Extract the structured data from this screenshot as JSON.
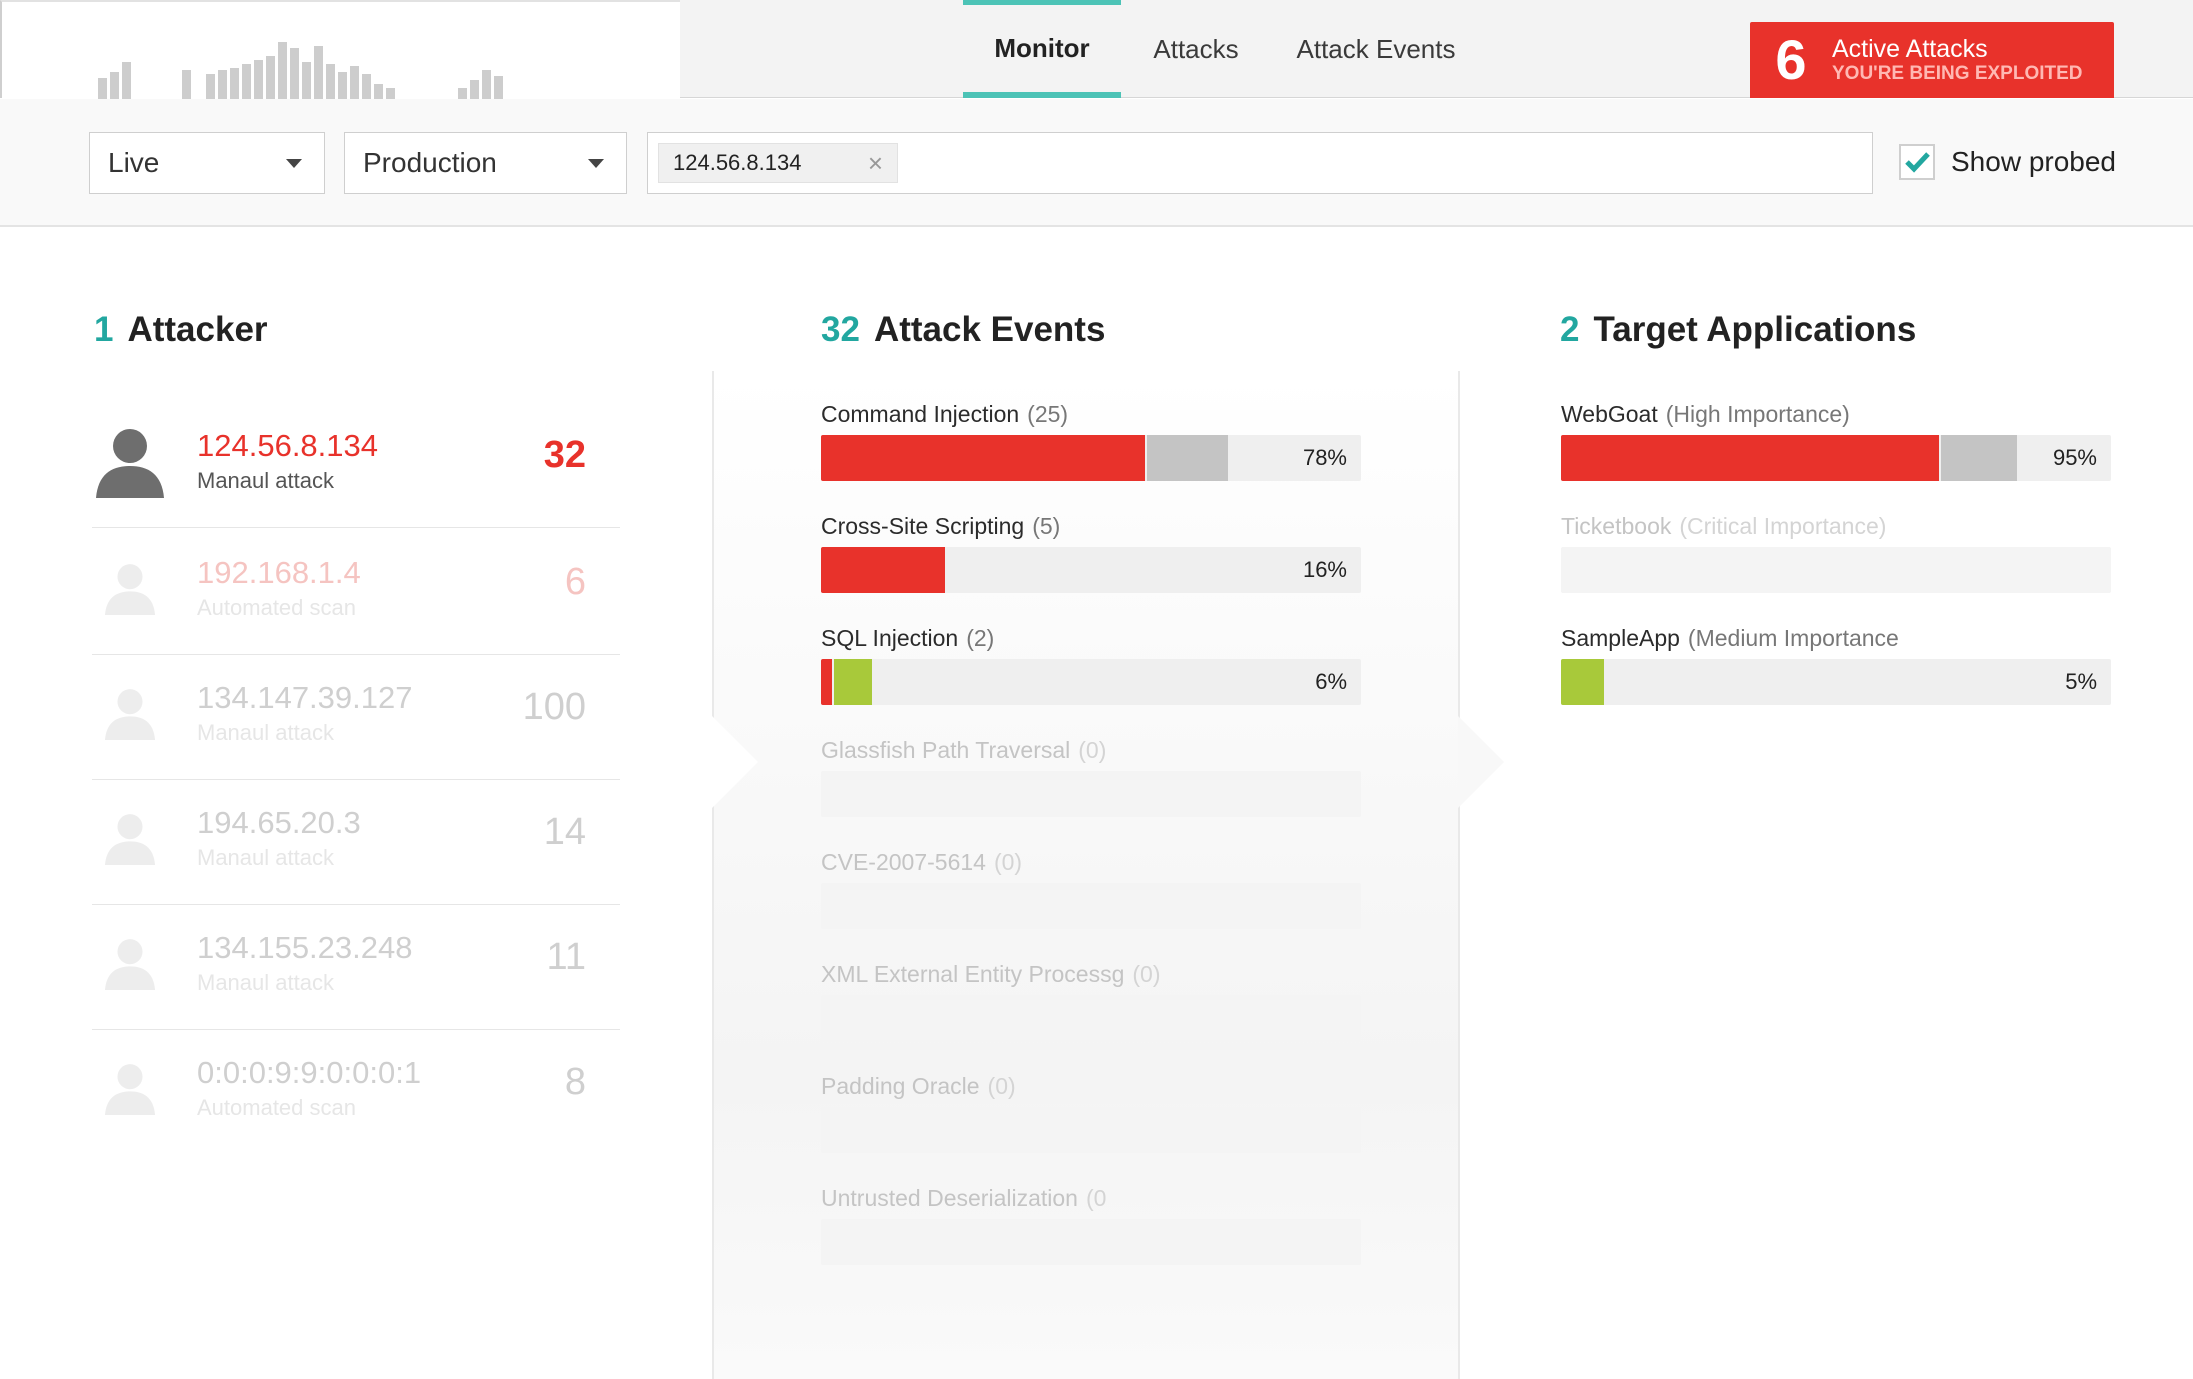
{
  "nav": {
    "tabs": [
      {
        "label": "Monitor",
        "active": true
      },
      {
        "label": "Attacks",
        "active": false
      },
      {
        "label": "Attack Events",
        "active": false
      }
    ]
  },
  "activity_histogram": [
    22,
    28,
    38,
    0,
    0,
    0,
    0,
    30,
    0,
    26,
    30,
    32,
    36,
    40,
    44,
    58,
    52,
    38,
    54,
    36,
    28,
    34,
    26,
    16,
    12,
    0,
    0,
    0,
    0,
    0,
    12,
    20,
    30,
    24
  ],
  "alert": {
    "count": "6",
    "title": "Active Attacks",
    "subtitle": "YOU'RE BEING EXPLOITED"
  },
  "filters": {
    "mode": "Live",
    "environment": "Production",
    "tag": "124.56.8.134",
    "tag_remove": "×",
    "show_probed_label": "Show probed",
    "show_probed_checked": true
  },
  "attackers_section": {
    "count": "1",
    "title": "Attacker"
  },
  "attackers": [
    {
      "ip": "124.56.8.134",
      "kind": "Manaul attack",
      "count": "32",
      "state": "active"
    },
    {
      "ip": "192.168.1.4",
      "kind": "Automated scan",
      "count": "6",
      "state": "faded-red"
    },
    {
      "ip": "134.147.39.127",
      "kind": "Manaul attack",
      "count": "100",
      "state": "faded"
    },
    {
      "ip": "194.65.20.3",
      "kind": "Manaul attack",
      "count": "14",
      "state": "faded"
    },
    {
      "ip": "134.155.23.248",
      "kind": "Manaul attack",
      "count": "11",
      "state": "faded"
    },
    {
      "ip": "0:0:0:9:9:0:0:0:1",
      "kind": "Automated scan",
      "count": "8",
      "state": "faded"
    }
  ],
  "events_section": {
    "count": "32",
    "title": "Attack Events"
  },
  "events": [
    {
      "name": "Command Injection",
      "count": "(25)",
      "percent": "78%",
      "red": 0.6,
      "green": 0,
      "gray": 0.15,
      "dim": false
    },
    {
      "name": "Cross-Site Scripting",
      "count": "(5)",
      "percent": "16%",
      "red": 0.23,
      "green": 0,
      "gray": 0,
      "dim": false
    },
    {
      "name": "SQL Injection",
      "count": "(2)",
      "percent": "6%",
      "red": 0.02,
      "green": 0.07,
      "gray": 0,
      "dim": false
    },
    {
      "name": "Glassfish Path Traversal",
      "count": "(0)",
      "percent": "",
      "red": 0,
      "green": 0,
      "gray": 0,
      "dim": true
    },
    {
      "name": "CVE-2007-5614",
      "count": "(0)",
      "percent": "",
      "red": 0,
      "green": 0,
      "gray": 0,
      "dim": true
    },
    {
      "name": "XML External Entity Processg",
      "count": "(0)",
      "percent": "",
      "red": 0,
      "green": 0,
      "gray": 0,
      "dim": true
    },
    {
      "name": "Padding Oracle",
      "count": "(0)",
      "percent": "",
      "red": 0,
      "green": 0,
      "gray": 0,
      "dim": true
    },
    {
      "name": "Untrusted Deserialization",
      "count": "(0",
      "percent": "",
      "red": 0,
      "green": 0,
      "gray": 0,
      "dim": true
    }
  ],
  "targets_section": {
    "count": "2",
    "title": "Target Applications"
  },
  "targets": [
    {
      "name": "WebGoat",
      "importance": "(High Importance)",
      "percent": "95%",
      "red": 0.7,
      "green": 0,
      "gray": 0.14,
      "dim": false
    },
    {
      "name": "Ticketbook",
      "importance": "(Critical Importance)",
      "percent": "",
      "red": 0,
      "green": 0,
      "gray": 0,
      "dim": true
    },
    {
      "name": "SampleApp",
      "importance": "(Medium Importance",
      "percent": "5%",
      "red": 0,
      "green": 0.08,
      "gray": 0,
      "dim": false
    }
  ],
  "colors": {
    "accent": "#22a7a0",
    "red": "#e8322b",
    "green": "#a8c93a",
    "gray": "#c4c4c4",
    "faded_red": "#f5c4c1",
    "faded_gray": "#cfcfcf"
  }
}
